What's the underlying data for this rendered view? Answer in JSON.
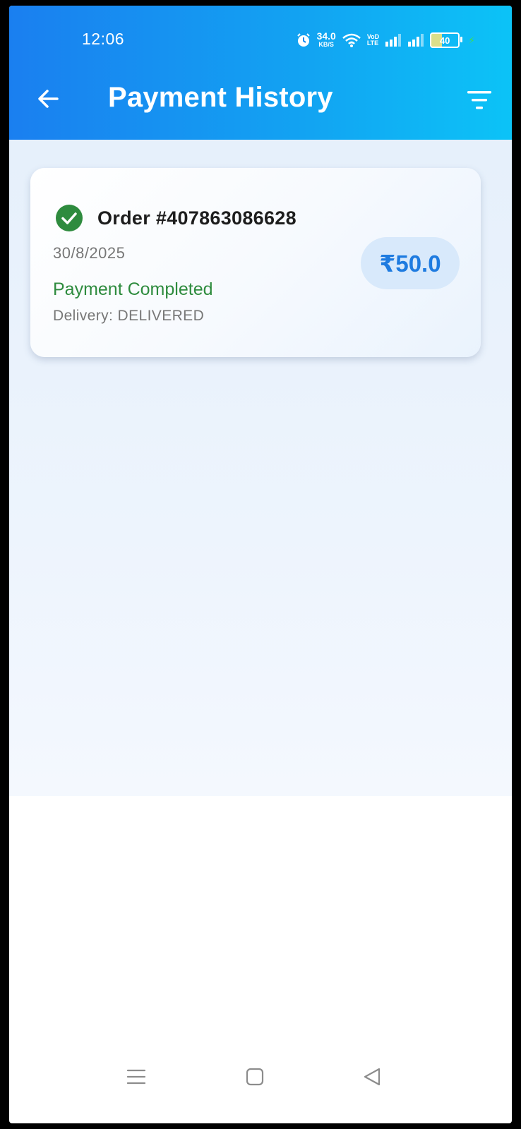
{
  "status_bar": {
    "time": "12:06",
    "net_speed_value": "34.0",
    "net_speed_unit": "KB/S",
    "volte_top": "VoD",
    "volte_bottom": "LTE",
    "battery_level": "40",
    "icons": [
      "alarm-icon",
      "wifi-icon",
      "signal-icon",
      "signal-icon",
      "battery-icon",
      "charging-icon"
    ]
  },
  "header": {
    "title": "Payment History",
    "back_icon": "arrow-left-icon",
    "filter_icon": "filter-icon"
  },
  "orders": [
    {
      "order_label": "Order #407863086628",
      "date": "30/8/2025",
      "payment_status": "Payment Completed",
      "delivery": "Delivery: DELIVERED",
      "amount": "₹50.0",
      "status_icon": "check-circle-icon"
    }
  ],
  "colors": {
    "header_start": "#1a7ff0",
    "header_end": "#0cc3f7",
    "success_green": "#2e8b3e",
    "amount_blue": "#1e7be0",
    "amount_pill_bg": "#d8e9fb"
  },
  "nav_bar": {
    "icons": [
      "menu-icon",
      "home-square-icon",
      "back-triangle-icon"
    ]
  }
}
